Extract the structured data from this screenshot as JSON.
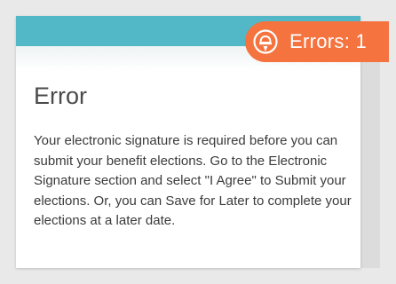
{
  "errors_badge": {
    "label": "Errors: 1",
    "icon": "alert-bell-icon",
    "color": "#f4733f"
  },
  "dialog": {
    "header_color": "#52b7c6",
    "title": "Error",
    "message": "Your electronic signature is required before you can submit your benefit elections. Go to the Electronic Signature section and select \"I Agree\" to Submit your elections. Or, you can Save for Later to complete your elections at a later date."
  }
}
